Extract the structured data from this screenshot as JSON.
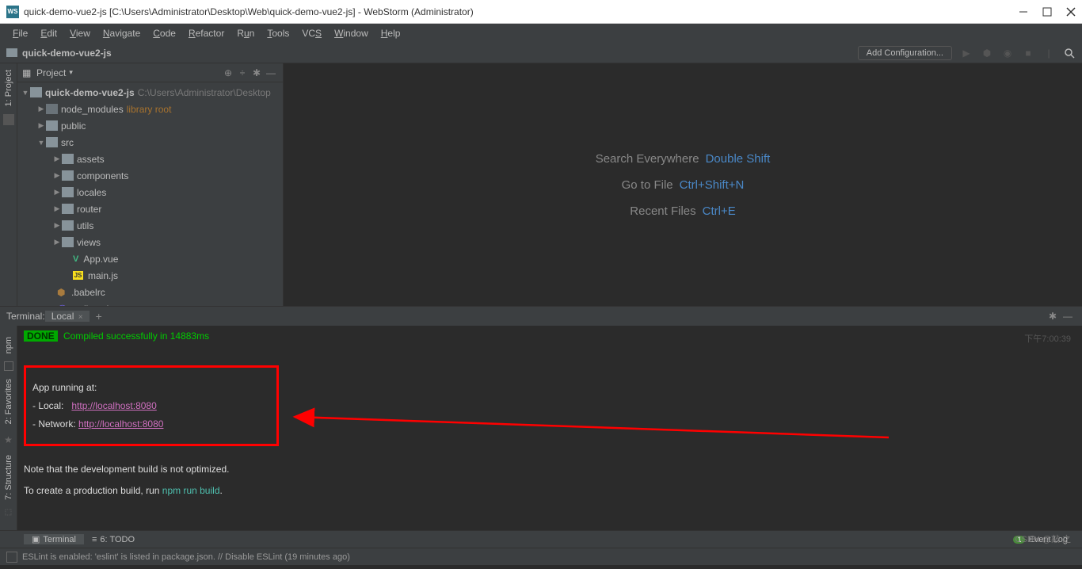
{
  "titlebar": {
    "app_icon": "WS",
    "title": "quick-demo-vue2-js [C:\\Users\\Administrator\\Desktop\\Web\\quick-demo-vue2-js] - WebStorm (Administrator)"
  },
  "menu": {
    "items": [
      "File",
      "Edit",
      "View",
      "Navigate",
      "Code",
      "Refactor",
      "Run",
      "Tools",
      "VCS",
      "Window",
      "Help"
    ]
  },
  "navbar": {
    "crumb": "quick-demo-vue2-js",
    "config": "Add Configuration..."
  },
  "left_strip": {
    "label": "1: Project"
  },
  "project": {
    "header": "Project",
    "root": {
      "name": "quick-demo-vue2-js",
      "path": "C:\\Users\\Administrator\\Desktop"
    },
    "node_modules": {
      "name": "node_modules",
      "tag": "library root"
    },
    "public": "public",
    "src": "src",
    "src_children": [
      "assets",
      "components",
      "locales",
      "router",
      "utils",
      "views"
    ],
    "app_vue": "App.vue",
    "main_js": "main.js",
    "babelrc": ".babelrc",
    "eslintrc": ".eslintrc.js"
  },
  "editor_hints": [
    {
      "label": "Search Everywhere",
      "shortcut": "Double Shift"
    },
    {
      "label": "Go to File",
      "shortcut": "Ctrl+Shift+N"
    },
    {
      "label": "Recent Files",
      "shortcut": "Ctrl+E"
    }
  ],
  "terminal": {
    "title": "Terminal:",
    "tab": "Local",
    "done": "DONE",
    "compiled": "Compiled successfully in 14883ms",
    "timestamp": "下午7:00:39",
    "app_running": "App running at:",
    "local_label": "- Local:",
    "local_url": "http://localhost:8080",
    "network_label": "- Network:",
    "network_url": "http://localhost:8080",
    "note1": "Note that the development build is not optimized.",
    "note2_a": "To create a production build, run ",
    "note2_b": "npm run build",
    "note2_c": "."
  },
  "left_tools": {
    "npm": "npm",
    "fav": "2: Favorites",
    "struct": "7: Structure"
  },
  "bottom": {
    "terminal": "Terminal",
    "todo": "6: TODO",
    "event_badge": "1",
    "event_log": "Event Log"
  },
  "status": "ESLint is enabled: 'eslint' is listed in package.json. // Disable ESLint (19 minutes ago)",
  "watermark": "CSDN @敲 之"
}
